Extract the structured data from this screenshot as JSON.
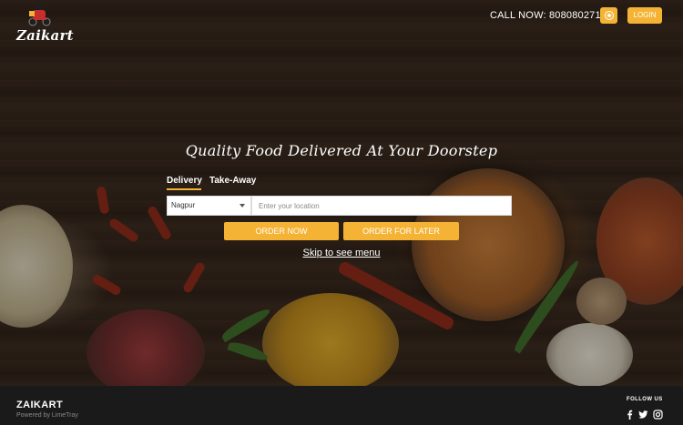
{
  "header": {
    "logo_text": "Zaikart",
    "call_label": "CALL NOW: 8080802711",
    "login_label": "LOGIN"
  },
  "hero": {
    "tagline": "Quality Food Delivered At Your Doorstep",
    "tabs": [
      "Delivery",
      "Take-Away"
    ],
    "city": "Nagpur",
    "location_placeholder": "Enter your location",
    "order_now_label": "ORDER NOW",
    "order_later_label": "ORDER FOR LATER",
    "skip_label": "Skip to see menu"
  },
  "footer": {
    "brand": "ZAIKART",
    "powered_by": "Powered by LimeTray",
    "follow_label": "FOLLOW US"
  },
  "colors": {
    "accent": "#f5b335",
    "footer_bg": "#1a1a1a"
  },
  "icons": [
    "star-icon",
    "caret-down-icon",
    "facebook-icon",
    "twitter-icon",
    "instagram-icon"
  ]
}
